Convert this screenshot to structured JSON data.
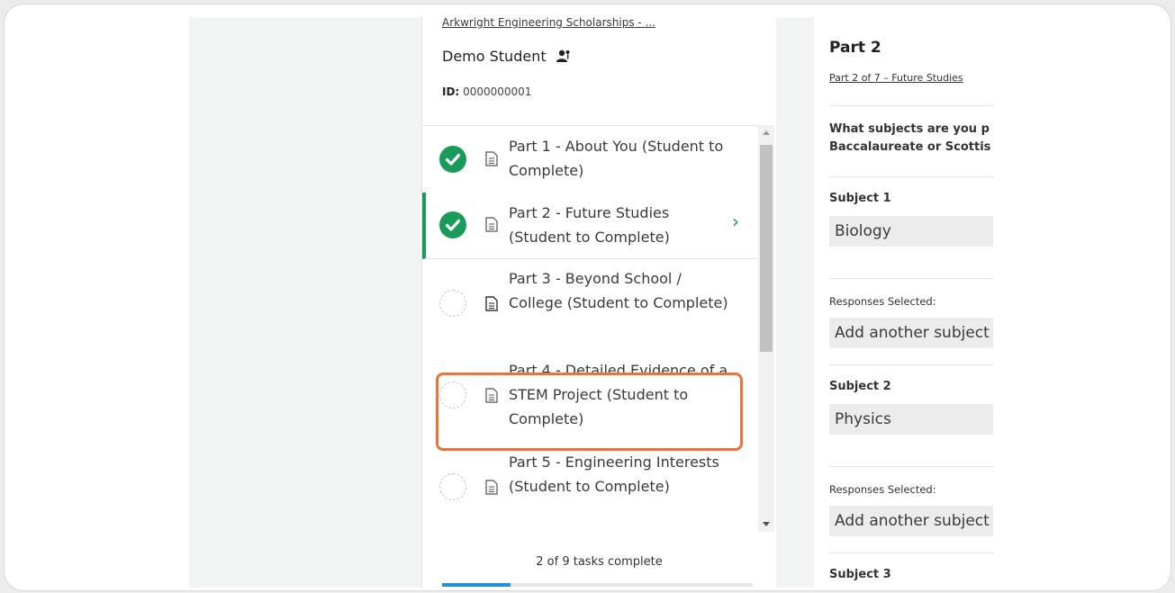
{
  "left_panel": {
    "app_link": "Arkwright Engineering Scholarships - ...",
    "student_name": "Demo Student",
    "id_label": "ID:",
    "id_value": "0000000001",
    "items": [
      {
        "label": "Part 1 - About You (Student to Complete)",
        "status": "complete"
      },
      {
        "label": "Part 2 - Future Studies (Student to Complete)",
        "status": "complete",
        "active": true
      },
      {
        "label": "Part 3 - Beyond School / College (Student to Complete)",
        "status": "incomplete",
        "highlighted": true
      },
      {
        "label": "Part 4 - Detailed Evidence of a STEM Project (Student to Complete)",
        "status": "incomplete"
      },
      {
        "label": "Part 5 - Engineering Interests (Student to Complete)",
        "status": "incomplete"
      }
    ],
    "tasks_complete": "2 of 9 tasks complete",
    "progress_fraction": 0.22
  },
  "right_panel": {
    "title": "Part 2",
    "subtitle": "Part 2 of 7 – Future Studies",
    "question_line1": "What subjects are you p",
    "question_line2": "Baccalaureate or Scottis",
    "subject1_label": "Subject 1",
    "subject1_value": "Biology",
    "responses1_label": "Responses Selected:",
    "add1": "Add another subject",
    "subject2_label": "Subject 2",
    "subject2_value": "Physics",
    "responses2_label": "Responses Selected:",
    "add2": "Add another subject",
    "subject3_label": "Subject 3"
  },
  "colors": {
    "complete": "#1a9b5a",
    "highlight": "#e8753a",
    "progress": "#1f8fd6"
  },
  "icons": {
    "complete": "check-circle-icon",
    "incomplete": "dashed-circle-icon",
    "document": "document-icon",
    "student": "user-group-icon",
    "active": "chevron-right-icon"
  }
}
